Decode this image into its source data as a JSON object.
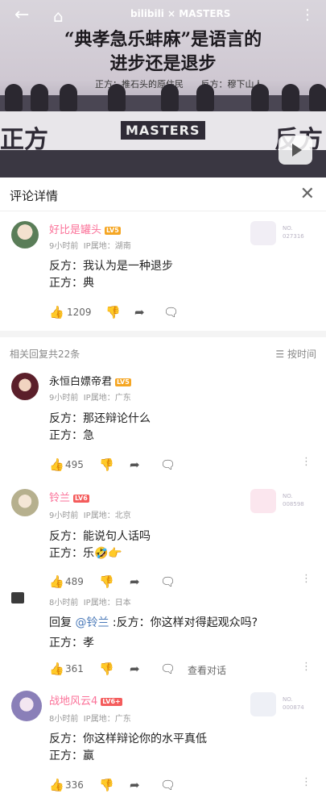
{
  "video": {
    "banner_title_line1": "“典孝急乐蚌麻”是语言的",
    "banner_title_line2": "进步还是退步",
    "pro_side": "正方：推石头的原住民",
    "con_side": "反方：穆下山人",
    "stage_left": "正方",
    "stage_right": "反方",
    "stage_brand": "MASTERS",
    "logo": "bilibili × MASTERS"
  },
  "panel": {
    "title": "评论详情"
  },
  "main_comment": {
    "username": "好比是罐头",
    "level": "LV5",
    "time": "9小时前",
    "ip": "IP属地：湖南",
    "line1": "反方：我认为是一种退步",
    "line2": "正方：典",
    "likes": "1209",
    "badge_no": "NO.",
    "badge_num": "027316",
    "colors": {
      "username": "#fb7299",
      "level": "#f5a623"
    }
  },
  "replies_header": {
    "count": "相关回复共22条",
    "sort": "按时间"
  },
  "replies": [
    {
      "username": "永恒白嫖帝君",
      "level": "LV5",
      "time": "9小时前",
      "ip": "IP属地：广东",
      "line1": "反方：那还辩论什么",
      "line2": "正方：急",
      "likes": "495"
    },
    {
      "username": "铃兰",
      "level": "LV6",
      "time": "9小时前",
      "ip": "IP属地：北京",
      "line1": "反方：能说句人话吗",
      "line2": "正方：乐🤣👉",
      "likes": "489",
      "badge_no": "NO.",
      "badge_num": "008598"
    },
    {
      "username": "",
      "level": "",
      "time": "8小时前",
      "ip": "IP属地：日本",
      "reply_prefix": "回复",
      "reply_to": "@铃兰",
      "line1": ":反方：你这样对得起观众吗?",
      "line2": "正方：孝",
      "likes": "361",
      "view_thread": "查看对话"
    },
    {
      "username": "战地风云4",
      "level": "LV6+",
      "time": "8小时前",
      "ip": "IP属地：广东",
      "line1": "反方：你这样辩论你的水平真低",
      "line2": "正方：赢",
      "likes": "336",
      "badge_no": "NO.",
      "badge_num": "000874"
    }
  ],
  "icons": {
    "like": "thumbs-up-icon",
    "dislike": "thumbs-down-icon",
    "share": "share-icon",
    "comment": "comment-icon"
  }
}
